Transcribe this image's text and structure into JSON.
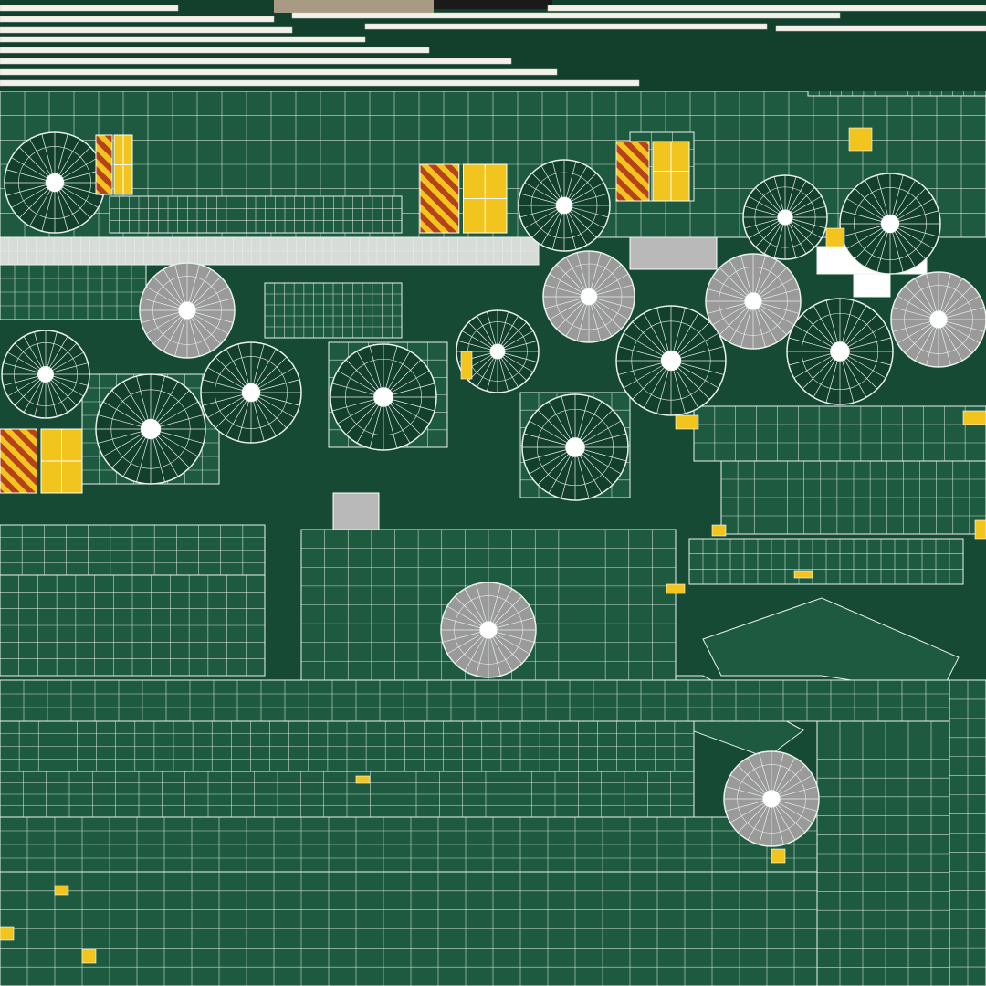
{
  "colors": {
    "background": "#164a35",
    "panel": "#1d5a40",
    "panel_dark": "#12402d",
    "wire": "#e9f1ec",
    "dish_fill": "#9a9a9a",
    "hazard_yellow": "#f2c51e",
    "hazard_red": "#b6421c",
    "gray_panel": "#b9b9b9",
    "header_stripe": "#f3f1ea",
    "header_tan": "#a89a83",
    "maroon_box": "#6a1e1a"
  }
}
